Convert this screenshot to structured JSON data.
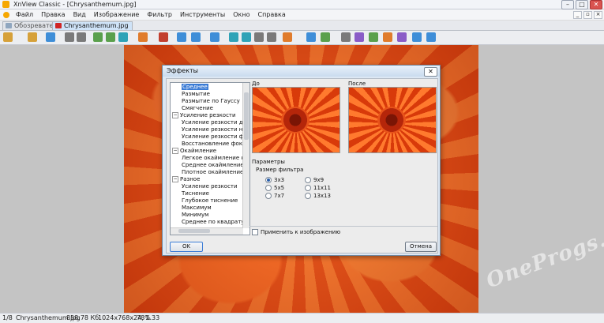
{
  "window": {
    "title": "XnView Classic - [Chrysanthemum.jpg]",
    "min_label": "–",
    "max_label": "□",
    "close_label": "✕"
  },
  "menu": {
    "items": [
      "Файл",
      "Правка",
      "Вид",
      "Изображение",
      "Фильтр",
      "Инструменты",
      "Окно",
      "Справка"
    ],
    "mdi": [
      "_",
      "▫",
      "×"
    ]
  },
  "tabs": [
    {
      "label": "Обозреватель"
    },
    {
      "label": "Chrysanthemum.jpg"
    }
  ],
  "dialog": {
    "title": "Эффекты",
    "close_label": "✕",
    "tree": [
      {
        "label": "Среднее",
        "indent": 2,
        "selected": true
      },
      {
        "label": "Размытие",
        "indent": 2
      },
      {
        "label": "Размытие по Гауссу",
        "indent": 2
      },
      {
        "label": "Смягчение",
        "indent": 2
      },
      {
        "label": "Усиление резкости",
        "indent": 1,
        "expander": "−"
      },
      {
        "label": "Усиление резкости де",
        "indent": 2
      },
      {
        "label": "Усиление резкости на",
        "indent": 2
      },
      {
        "label": "Усиление резкости фо",
        "indent": 2
      },
      {
        "label": "Восстановление фоку",
        "indent": 2
      },
      {
        "label": "Окаймление",
        "indent": 1,
        "expander": "−"
      },
      {
        "label": "Легкое окаймление кр",
        "indent": 2
      },
      {
        "label": "Среднее окаймление к",
        "indent": 2
      },
      {
        "label": "Плотное окаймление к",
        "indent": 2
      },
      {
        "label": "Разное",
        "indent": 1,
        "expander": "−"
      },
      {
        "label": "Усиление резкости",
        "indent": 2
      },
      {
        "label": "Тиснение",
        "indent": 2
      },
      {
        "label": "Глубокое тиснение",
        "indent": 2
      },
      {
        "label": "Максимум",
        "indent": 2
      },
      {
        "label": "Минимум",
        "indent": 2
      },
      {
        "label": "Среднее по квадрату",
        "indent": 2
      }
    ],
    "before_label": "До",
    "after_label": "После",
    "params_label": "Параметры",
    "filter_size_label": "Размер фильтра",
    "sizes": [
      {
        "label": "3x3",
        "checked": true
      },
      {
        "label": "9x9",
        "checked": false
      },
      {
        "label": "5x5",
        "checked": false
      },
      {
        "label": "11x11",
        "checked": false
      },
      {
        "label": "7x7",
        "checked": false
      },
      {
        "label": "13x13",
        "checked": false
      }
    ],
    "apply_label": "Применить к изображению",
    "ok_label": "OK",
    "cancel_label": "Отмена"
  },
  "status": {
    "page": "1/8",
    "filename": "Chrysanthemum.jpg",
    "size": "858.78 Кб",
    "dims": "1024x768x24, 1.33",
    "zoom": "78%"
  },
  "watermark": "OneProgs.ru"
}
